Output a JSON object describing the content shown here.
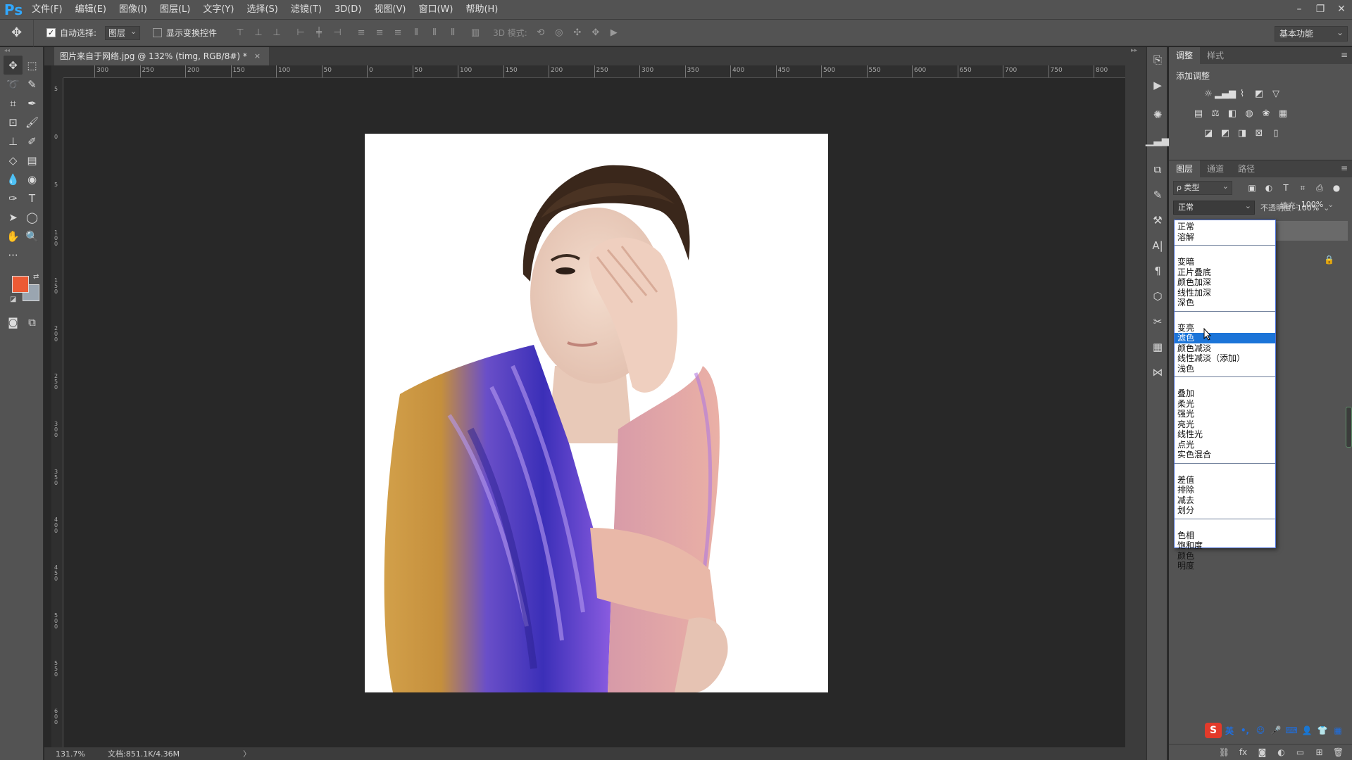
{
  "app": {
    "logo": "Ps",
    "menu": [
      "文件(F)",
      "编辑(E)",
      "图像(I)",
      "图层(L)",
      "文字(Y)",
      "选择(S)",
      "滤镜(T)",
      "3D(D)",
      "视图(V)",
      "窗口(W)",
      "帮助(H)"
    ],
    "window_controls": [
      "–",
      "❐",
      "✕"
    ]
  },
  "options_bar": {
    "auto_select_label": "自动选择:",
    "auto_select_checked": true,
    "auto_select_target": "图层",
    "show_transform_label": "显示变换控件",
    "show_transform_checked": false,
    "mode_3d_label": "3D 模式:",
    "workspace": "基本功能"
  },
  "document": {
    "tab_title": "图片来自于网络.jpg @ 132% (timg, RGB/8#) *",
    "close_glyph": "×"
  },
  "rulers": {
    "top_labels": [
      "300",
      "250",
      "200",
      "150",
      "100",
      "50",
      "0",
      "50",
      "100",
      "150",
      "200",
      "250",
      "300",
      "350",
      "400",
      "450",
      "500",
      "550",
      "600",
      "650",
      "700",
      "750",
      "800"
    ],
    "left_labels": [
      "5",
      "0",
      "5",
      "1 0 0",
      "1 5 0",
      "2 0 0",
      "2 5 0",
      "3 0 0",
      "3 5 0",
      "4 0 0",
      "4 5 0",
      "5 0 0",
      "5 5 0",
      "6 0 0"
    ]
  },
  "status": {
    "zoom": "131.7%",
    "doc_size": "文档:851.1K/4.36M",
    "arrow": "〉"
  },
  "colors": {
    "foreground": "#ec5a34",
    "background": "#9aa5b0",
    "selection": "#1b74d8",
    "accent": "#31a8ff"
  },
  "adjustments_panel": {
    "tabs": [
      "调整",
      "样式"
    ],
    "title": "添加调整",
    "icons_row1": [
      "brightness-icon",
      "levels-icon",
      "curves-icon",
      "exposure-icon",
      "vibrance-icon"
    ],
    "icons_row2": [
      "hue-icon",
      "color-balance-icon",
      "bw-icon",
      "photo-filter-icon",
      "channel-mixer-icon",
      "color-lookup-icon"
    ],
    "icons_row3": [
      "invert-icon",
      "posterize-icon",
      "threshold-icon",
      "selective-color-icon",
      "gradient-map-icon"
    ]
  },
  "layers_panel": {
    "tabs": [
      "图层",
      "通道",
      "路径"
    ],
    "filter_kind": "ρ 类型",
    "blend_mode": "正常",
    "opacity_label": "不透明度:",
    "opacity_value": "100%",
    "fill_label": "填充:",
    "fill_value": "100%"
  },
  "blend_modes": {
    "groups": [
      [
        "正常",
        "溶解"
      ],
      [
        "变暗",
        "正片叠底",
        "颜色加深",
        "线性加深",
        "深色"
      ],
      [
        "变亮",
        "滤色",
        "颜色减淡",
        "线性减淡（添加）",
        "浅色"
      ],
      [
        "叠加",
        "柔光",
        "强光",
        "亮光",
        "线性光",
        "点光",
        "实色混合"
      ],
      [
        "差值",
        "排除",
        "减去",
        "划分"
      ],
      [
        "色相",
        "饱和度",
        "颜色",
        "明度"
      ]
    ],
    "selected": "滤色"
  },
  "ime": {
    "logo": "S",
    "items": [
      "英",
      "•,",
      "☺",
      "🎤",
      "⌨",
      "👤",
      "👕",
      "▦"
    ]
  }
}
